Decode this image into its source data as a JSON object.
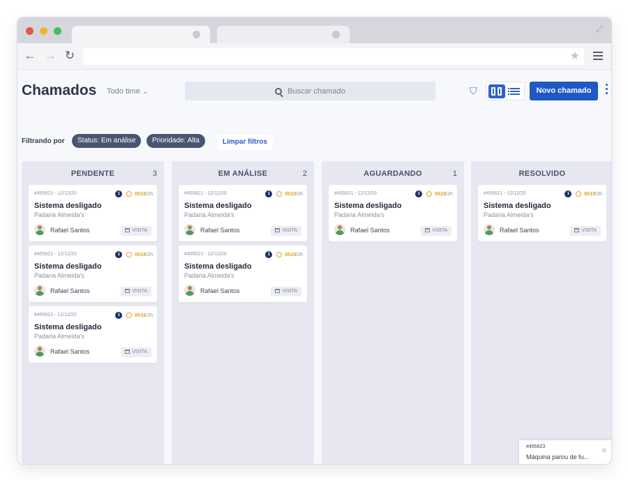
{
  "browser": {
    "dots": [
      {
        "name": "close-dot",
        "color": "#e25650"
      },
      {
        "name": "minimize-dot",
        "color": "#f0b52f"
      },
      {
        "name": "maximize-dot",
        "color": "#3fbf55"
      }
    ],
    "url": ""
  },
  "header": {
    "title": "Chamados",
    "team_select": "Todo time",
    "search_placeholder": "Buscar chamado",
    "new_button": "Novo chamado"
  },
  "filters": {
    "label": "Filtrando por",
    "chips": [
      "Status: Em análise",
      "Prioridade: Alta"
    ],
    "clear_label": "Limpar filtros"
  },
  "columns": [
    {
      "title": "PENDENTE",
      "count": "3",
      "cards": [
        {
          "id": "#455621 - 12/12/20",
          "badge": "1",
          "time": "0h15",
          "total": "/2h",
          "title": "Sistema desligado",
          "client": "Padaria Almeida's",
          "assignee": "Rafael Santos",
          "tag": "VISITA"
        },
        {
          "id": "#455621 - 12/12/20",
          "badge": "1",
          "time": "0h15",
          "total": "/2h",
          "title": "Sistema desligado",
          "client": "Padaria Almeida's",
          "assignee": "Rafael Santos",
          "tag": "VISITA"
        },
        {
          "id": "#455621 - 12/12/20",
          "badge": "1",
          "time": "0h15",
          "total": "/2h",
          "title": "Sistema desligado",
          "client": "Padaria Almeida's",
          "assignee": "Rafael Santos",
          "tag": "VISITA"
        }
      ]
    },
    {
      "title": "EM ANÁLISE",
      "count": "2",
      "cards": [
        {
          "id": "#455621 - 12/12/20",
          "badge": "1",
          "time": "0h15",
          "total": "/2h",
          "title": "Sistema desligado",
          "client": "Padaria Almeida's",
          "assignee": "Rafael Santos",
          "tag": "VISITA"
        },
        {
          "id": "#455621 - 12/12/20",
          "badge": "1",
          "time": "0h15",
          "total": "/2h",
          "title": "Sistema desligado",
          "client": "Padaria Almeida's",
          "assignee": "Rafael Santos",
          "tag": "VISITA"
        }
      ]
    },
    {
      "title": "AGUARDANDO",
      "count": "1",
      "cards": [
        {
          "id": "#455621 - 12/12/20",
          "badge": "1",
          "time": "0h15",
          "total": "/2h",
          "title": "Sistema desligado",
          "client": "Padaria Almeida's",
          "assignee": "Rafael Santos",
          "tag": "VISITA"
        }
      ]
    },
    {
      "title": "RESOLVIDO",
      "count": "",
      "cards": [
        {
          "id": "#455621 - 12/12/20",
          "badge": "1",
          "time": "0h15",
          "total": "/2h",
          "title": "Sistema desligado",
          "client": "Padaria Almeida's",
          "assignee": "Rafael Santos",
          "tag": "VISITA"
        }
      ]
    }
  ],
  "toast": {
    "id": "#455623",
    "message": "Máquina parou de fu..."
  },
  "icons": {
    "filter": "filter-icon",
    "board_view": "board-view-icon",
    "list_view": "list-view-icon",
    "search": "search-icon",
    "more": "more-vertical-icon"
  }
}
